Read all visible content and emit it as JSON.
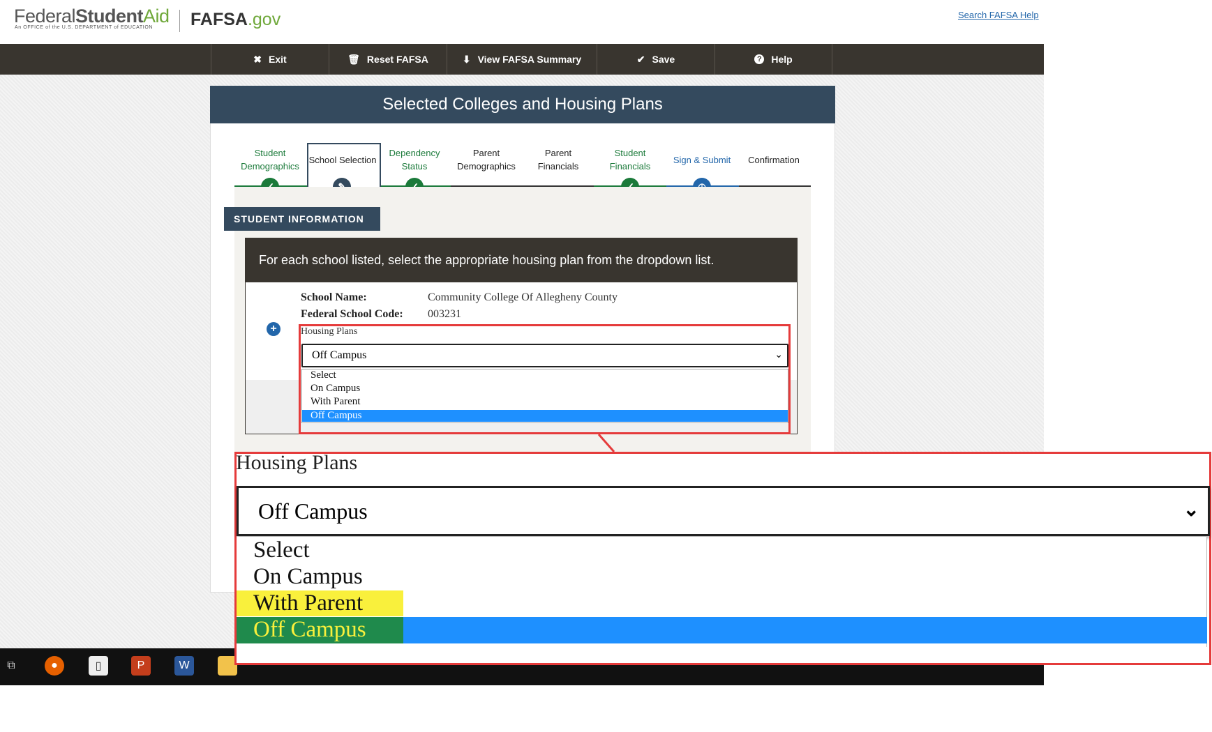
{
  "brand": {
    "federal": "Federal",
    "student": "Student",
    "aid": "Aid",
    "subtitle": "An OFFICE of the U.S. DEPARTMENT of EDUCATION",
    "fafsa": "FAFSA",
    "gov": ".gov"
  },
  "header": {
    "help_link": "Search FAFSA Help"
  },
  "nav": [
    {
      "label": "Exit",
      "icon": "close-circle-icon",
      "glyph": "✖"
    },
    {
      "label": "Reset FAFSA",
      "icon": "trash-icon",
      "glyph": "🗑"
    },
    {
      "label": "View FAFSA Summary",
      "icon": "download-icon",
      "glyph": "⬇"
    },
    {
      "label": "Save",
      "icon": "check-icon",
      "glyph": "✔"
    },
    {
      "label": "Help",
      "icon": "question-circle-icon",
      "glyph": "?"
    }
  ],
  "page": {
    "title": "Selected Colleges and Housing Plans"
  },
  "steps": [
    {
      "label1": "Student",
      "label2": "Demographics",
      "status": "complete"
    },
    {
      "label1": "School Selection",
      "label2": "",
      "status": "current"
    },
    {
      "label1": "Dependency",
      "label2": "Status",
      "status": "complete"
    },
    {
      "label1": "Parent",
      "label2": "Demographics",
      "status": "pending"
    },
    {
      "label1": "Parent",
      "label2": "Financials",
      "status": "pending"
    },
    {
      "label1": "Student",
      "label2": "Financials",
      "status": "complete"
    },
    {
      "label1": "Sign & Submit",
      "label2": "",
      "status": "in-progress"
    },
    {
      "label1": "Confirmation",
      "label2": "",
      "status": "pending"
    }
  ],
  "section": {
    "title": "STUDENT INFORMATION",
    "instruction": "For each school listed, select the appropriate housing plan from the dropdown list."
  },
  "school": {
    "name_label": "School Name:",
    "name_value": "Community College Of Allegheny County",
    "code_label": "Federal School Code:",
    "code_value": "003231",
    "housing_label": "Housing Plans",
    "housing_selected": "Off Campus",
    "housing_options": [
      "Select",
      "On Campus",
      "With Parent",
      "Off Campus"
    ]
  },
  "zoom": {
    "label": "Housing Plans",
    "selected": "Off Campus",
    "options": [
      "Select",
      "On Campus",
      "With Parent",
      "Off Campus"
    ],
    "highlight_colors": {
      "with_parent": "#f9f03c",
      "off_campus": "#1f8a4c",
      "selected_row": "#1e90ff"
    }
  },
  "colors": {
    "nav_bg": "#39352f",
    "header_bg": "#344a5e",
    "accent_green": "#6fa83a",
    "callout_red": "#e53b3b"
  }
}
